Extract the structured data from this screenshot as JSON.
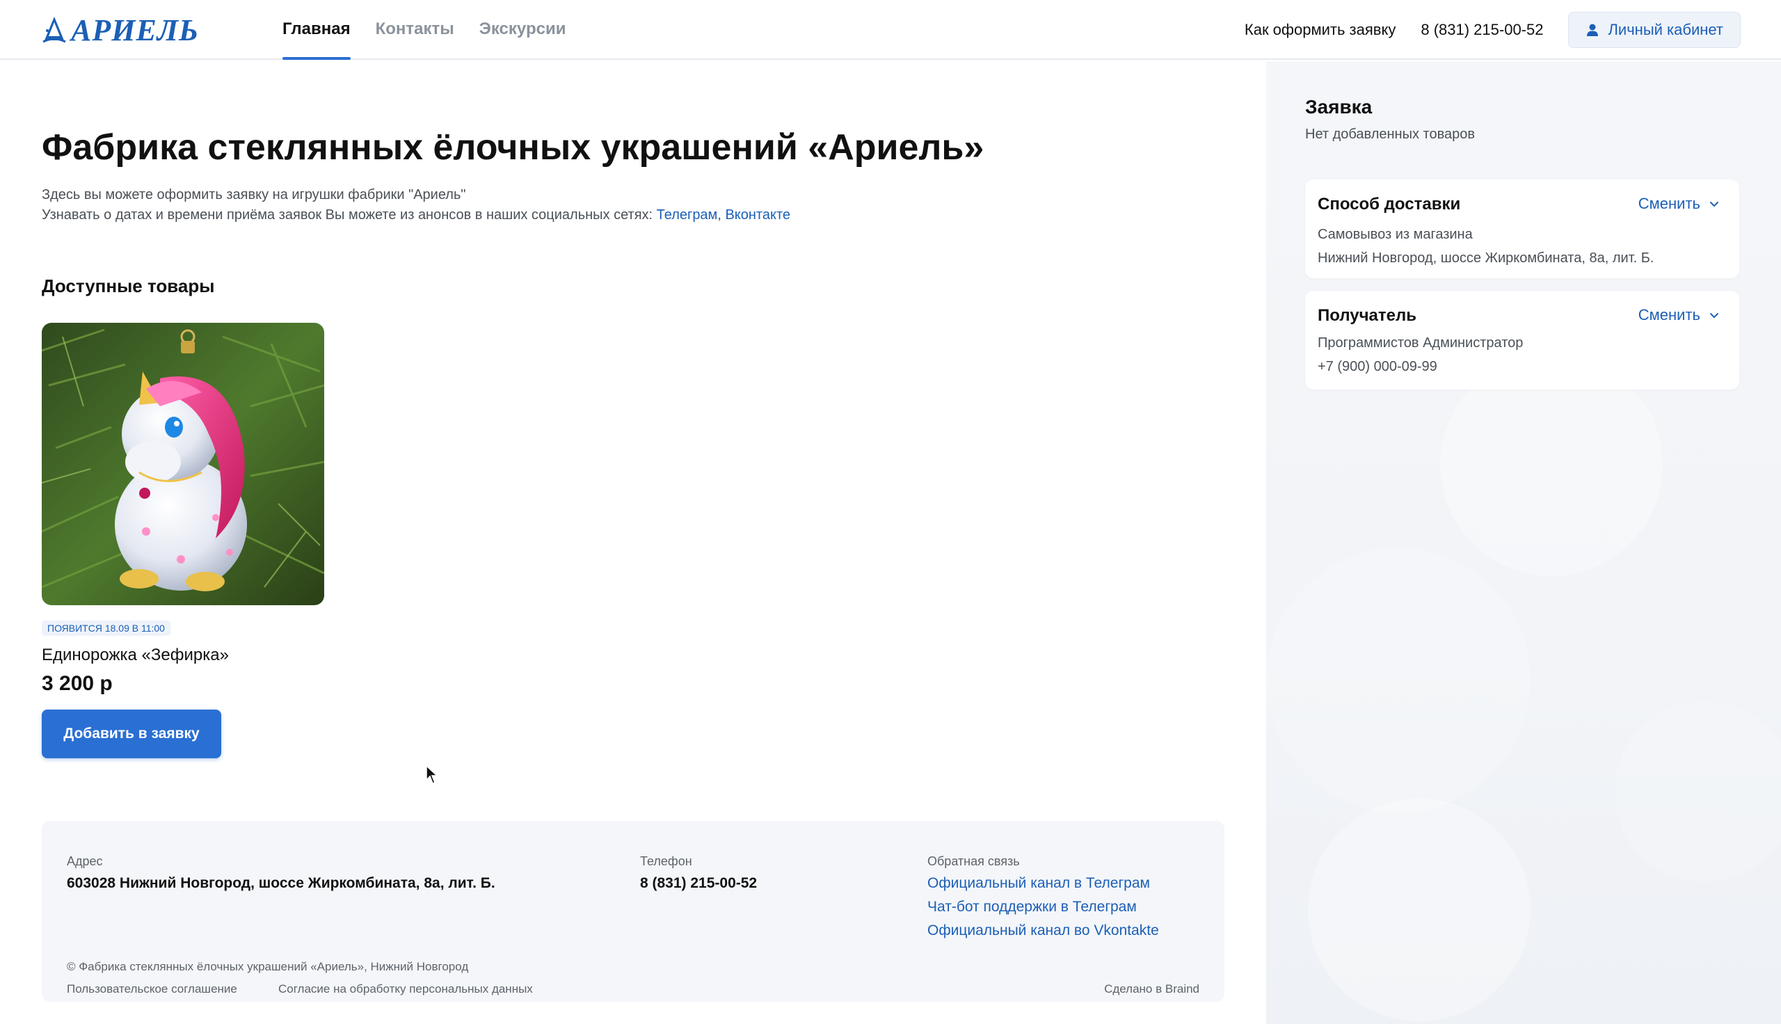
{
  "header": {
    "logo_text": "АРИЕЛЬ",
    "nav": [
      {
        "label": "Главная",
        "active": true
      },
      {
        "label": "Контакты",
        "active": false
      },
      {
        "label": "Экскурсии",
        "active": false
      }
    ],
    "how_to_order": "Как оформить заявку",
    "phone": "8 (831) 215-00-52",
    "cabinet_label": "Личный кабинет"
  },
  "main": {
    "title": "Фабрика стеклянных ёлочных украшений «Ариель»",
    "intro_line1": "Здесь вы можете оформить заявку на игрушки фабрики \"Ариель\"",
    "intro_line2": "Узнавать о датах и времени приёма заявок Вы можете из анонсов в наших социальных сетях:",
    "link_telegram": "Телеграм",
    "link_separator": ",",
    "link_vk": "Вконтакте",
    "section_title": "Доступные товары",
    "product": {
      "badge": "появится 18.09 в 11:00",
      "name": "Единорожка «Зефирка»",
      "price": "3 200 р",
      "add_button": "Добавить в заявку"
    }
  },
  "footer": {
    "address_label": "Адрес",
    "address_value": "603028 Нижний Новгород, шоссе Жиркомбината, 8а, лит. Б.",
    "phone_label": "Телефон",
    "phone_value": "8 (831) 215-00-52",
    "feedback_label": "Обратная связь",
    "feedback_links": [
      "Официальный канал в Телеграм",
      "Чат-бот поддержки в Телеграм",
      "Официальный канал во Vkontakte"
    ],
    "copyright": "© Фабрика стеклянных ёлочных украшений «Ариель», Нижний Новгород",
    "user_agreement": "Пользовательское соглашение",
    "personal_data": "Согласие на обработку персональных данных",
    "made_by": "Сделано в Braind"
  },
  "sidebar": {
    "title": "Заявка",
    "empty_text": "Нет добавленных товаров",
    "delivery": {
      "title": "Способ доставки",
      "change": "Сменить",
      "line1": "Самовывоз из магазина",
      "line2": "Нижний Новгород, шоссе Жиркомбината, 8а, лит. Б."
    },
    "recipient": {
      "title": "Получатель",
      "change": "Сменить",
      "line1": "Программистов Администратор",
      "line2": "+7 (900) 000-09-99"
    }
  },
  "colors": {
    "accent": "#2a6fd3",
    "link": "#1c5fb6",
    "sidebar_bg": "#f4f6f9"
  }
}
